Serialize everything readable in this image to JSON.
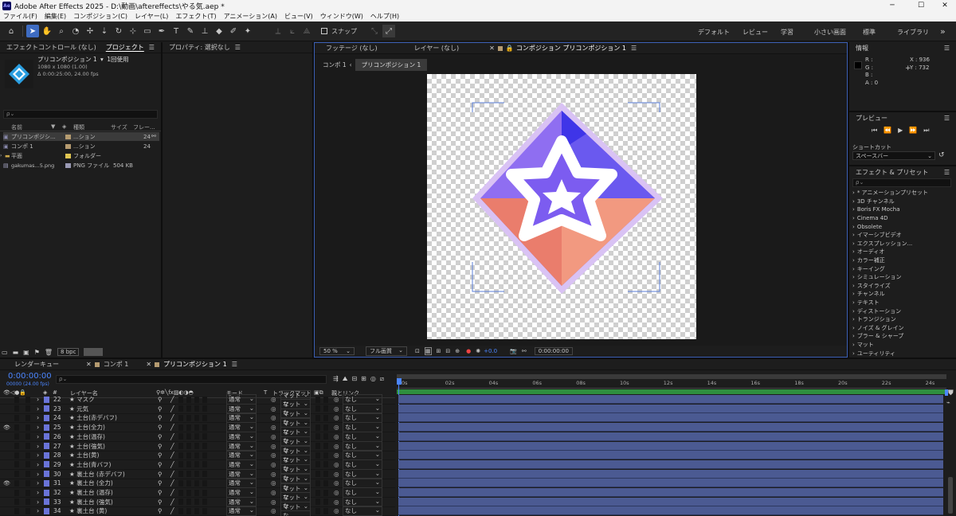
{
  "window": {
    "title": "Adobe After Effects 2025 - D:\\動画\\aftereffects\\やる気.aep *",
    "logo": "Ae",
    "controls": [
      "─",
      "☐",
      "✕"
    ]
  },
  "menu": [
    "ファイル(F)",
    "編集(E)",
    "コンポジション(C)",
    "レイヤー(L)",
    "エフェクト(T)",
    "アニメーション(A)",
    "ビュー(V)",
    "ウィンドウ(W)",
    "ヘルプ(H)"
  ],
  "toolbar": {
    "snap_label": "スナップ",
    "workspaces": [
      "デフォルト",
      "レビュー",
      "学習",
      "小さい画面",
      "標準",
      "ライブラリ"
    ]
  },
  "effect_controls": {
    "tab": "エフェクトコントロール (なし)"
  },
  "project": {
    "tab": "プロジェクト",
    "comp_name": "プリコンポジション 1",
    "usage": "1回使用",
    "size_line": "1080 x 1080 (1.00)",
    "dur_line": "Δ 0:00:25:00, 24.00 fps",
    "search_placeholder": "ρ⌄",
    "columns": [
      "名前",
      "種類",
      "サイズ",
      "フレー..."
    ],
    "items": [
      {
        "name": "プリコンポジシ...",
        "type": "...ション",
        "size": "",
        "frames": "24",
        "color": "#b59b70"
      },
      {
        "name": "コンポ 1",
        "type": "...ション",
        "size": "",
        "frames": "24",
        "color": "#b59b70"
      },
      {
        "name": "平面",
        "type": "フォルダー",
        "size": "",
        "frames": "",
        "color": "#e0c552"
      },
      {
        "name": "gakumas...5.png",
        "type": "PNG ファイル",
        "size": "504 KB",
        "frames": "",
        "color": "#9a9ab5"
      }
    ],
    "bpc": "8 bpc"
  },
  "properties": {
    "tab": "プロパティ: 選択なし"
  },
  "viewer": {
    "tabs": [
      "フッテージ (なし)",
      "レイヤー (なし)",
      "コンポジション プリコンポジション 1"
    ],
    "breadcrumb": [
      "コンポ 1",
      "プリコンポジション 1"
    ],
    "zoom": "50 %",
    "quality": "フル画質",
    "exposure": "+0.0",
    "timecode": "0:00:00:00"
  },
  "info": {
    "tab": "情報",
    "r": "R :",
    "g": "G :",
    "b": "B :",
    "a": "A :  0",
    "x": "X : 936",
    "y": "Y : 732"
  },
  "preview": {
    "tab": "プレビュー",
    "shortcut_label": "ショートカット",
    "shortcut_value": "スペースバー"
  },
  "effects": {
    "tab": "エフェクト & プリセット",
    "search": "ρ⌄",
    "items": [
      "* アニメーションプリセット",
      "3D チャンネル",
      "Boris FX Mocha",
      "Cinema 4D",
      "Obsolete",
      "イマーシブビデオ",
      "エクスプレッション...",
      "オーディオ",
      "カラー補正",
      "キーイング",
      "シミュレーション",
      "スタイライズ",
      "チャンネル",
      "テキスト",
      "ディストーション",
      "トランジション",
      "ノイズ & グレイン",
      "ブラー & シャープ",
      "マット",
      "ユーティリティ"
    ]
  },
  "timeline": {
    "tabs": [
      "レンダーキュー",
      "コンポ 1",
      "プリコンポジション 1"
    ],
    "timecode": "0:00:00:00",
    "frame_info": "00000 (24.00 fps)",
    "search": "ρ⌄",
    "headers": {
      "num": "#",
      "layer": "レイヤー名",
      "mode": "モード",
      "t": "T",
      "track": "トラックマット",
      "parent": "親とリンク"
    },
    "ruler": [
      "0s",
      "02s",
      "04s",
      "06s",
      "08s",
      "10s",
      "12s",
      "14s",
      "16s",
      "18s",
      "20s",
      "22s",
      "24s"
    ],
    "layers": [
      {
        "num": "22",
        "name": "★ マスク",
        "mode": "通常",
        "track": "マットな",
        "parent": "なし",
        "eye": false,
        "color": "#6a74d8"
      },
      {
        "num": "23",
        "name": "★ 元気",
        "mode": "通常",
        "track": "マットな",
        "parent": "なし",
        "eye": false,
        "color": "#6a74d8"
      },
      {
        "num": "24",
        "name": "★ 土台(赤デバフ)",
        "mode": "通常",
        "track": "マットな",
        "parent": "なし",
        "eye": false,
        "color": "#6a74d8"
      },
      {
        "num": "25",
        "name": "★ 土台(全力)",
        "mode": "通常",
        "track": "マットな",
        "parent": "なし",
        "eye": true,
        "color": "#6a74d8"
      },
      {
        "num": "26",
        "name": "★ 土台(温存)",
        "mode": "通常",
        "track": "マットな",
        "parent": "なし",
        "eye": false,
        "color": "#6a74d8"
      },
      {
        "num": "27",
        "name": "★ 土台(強気)",
        "mode": "通常",
        "track": "マットな",
        "parent": "なし",
        "eye": false,
        "color": "#6a74d8"
      },
      {
        "num": "28",
        "name": "★ 土台(黄)",
        "mode": "通常",
        "track": "マットな",
        "parent": "なし",
        "eye": false,
        "color": "#6a74d8"
      },
      {
        "num": "29",
        "name": "★ 土台(青バフ)",
        "mode": "通常",
        "track": "マットな",
        "parent": "なし",
        "eye": false,
        "color": "#6a74d8"
      },
      {
        "num": "30",
        "name": "★ 裏土台 (赤デバフ)",
        "mode": "通常",
        "track": "マットな",
        "parent": "なし",
        "eye": false,
        "color": "#6a74d8"
      },
      {
        "num": "31",
        "name": "★ 裏土台 (全力)",
        "mode": "通常",
        "track": "マットな",
        "parent": "なし",
        "eye": true,
        "color": "#6a74d8"
      },
      {
        "num": "32",
        "name": "★ 裏土台 (温存)",
        "mode": "通常",
        "track": "マットな",
        "parent": "なし",
        "eye": false,
        "color": "#6a74d8"
      },
      {
        "num": "33",
        "name": "★ 裏土台 (強気)",
        "mode": "通常",
        "track": "マットな",
        "parent": "なし",
        "eye": false,
        "color": "#6a74d8"
      },
      {
        "num": "34",
        "name": "★ 裏土台 (黄)",
        "mode": "通常",
        "track": "マットな",
        "parent": "なし",
        "eye": false,
        "color": "#6a74d8"
      }
    ]
  }
}
